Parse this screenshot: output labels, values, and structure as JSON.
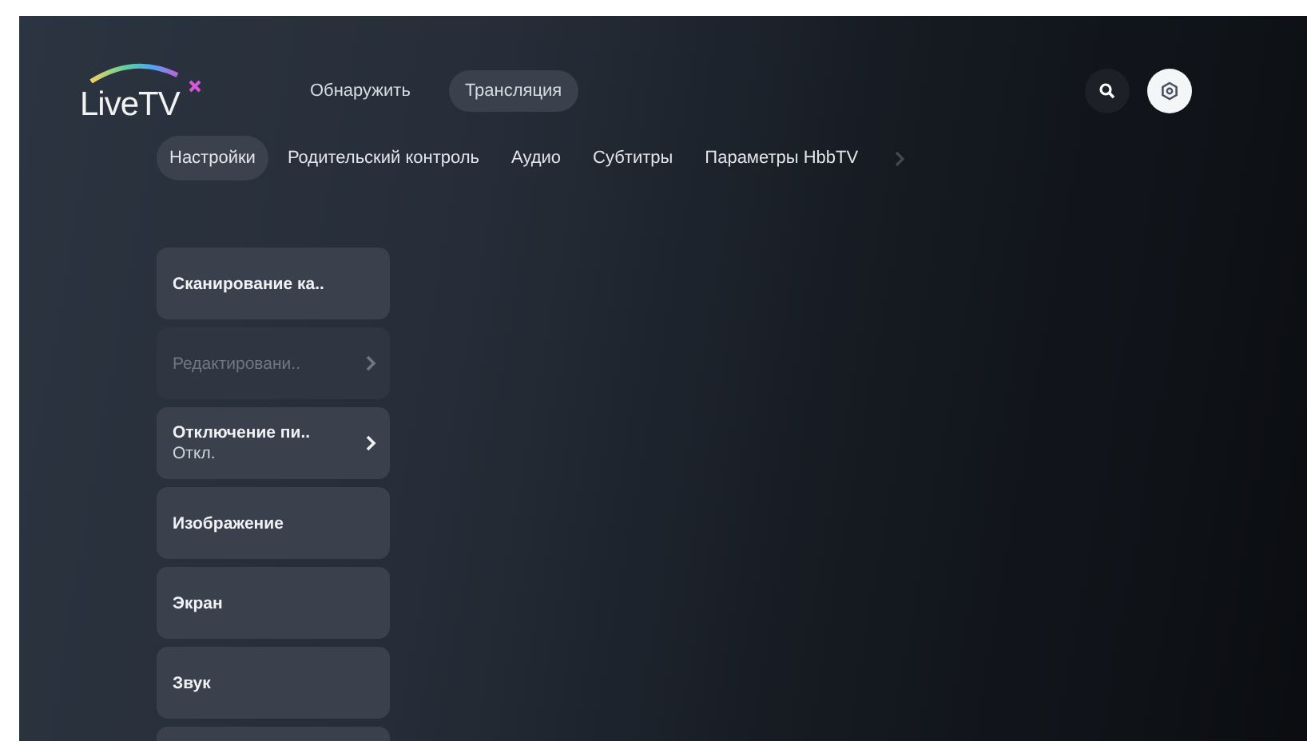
{
  "header": {
    "logo": "LiveTV",
    "nav": [
      {
        "label": "Обнаружить",
        "selected": false
      },
      {
        "label": "Трансляция",
        "selected": true
      }
    ],
    "settings_selected": true
  },
  "tabs": [
    {
      "label": "Настройки",
      "selected": true
    },
    {
      "label": "Родительский контроль",
      "selected": false
    },
    {
      "label": "Аудио",
      "selected": false
    },
    {
      "label": "Субтитры",
      "selected": false
    },
    {
      "label": "Параметры HbbTV",
      "selected": false
    }
  ],
  "menu": [
    {
      "label": "Сканирование ка..",
      "kind": "plain",
      "disabled": false
    },
    {
      "label": "Редактировани..",
      "kind": "submenu",
      "disabled": true
    },
    {
      "label": "Отключение пи..",
      "value": "Откл.",
      "kind": "submenu",
      "disabled": false
    },
    {
      "label": "Изображение",
      "kind": "plain",
      "disabled": false
    },
    {
      "label": "Экран",
      "kind": "plain",
      "disabled": false
    },
    {
      "label": "Звук",
      "kind": "plain",
      "disabled": false
    },
    {
      "kind": "partial"
    }
  ]
}
